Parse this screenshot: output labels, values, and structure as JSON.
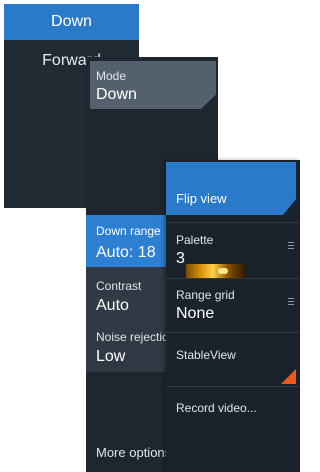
{
  "panel1": {
    "selected": "Down",
    "item": "Forward"
  },
  "panel2": {
    "mode_label": "Mode",
    "mode_value": "Down",
    "downrange_label": "Down range",
    "downrange_value": "Auto: 18",
    "contrast_label": "Contrast",
    "contrast_value": "Auto",
    "noise_label": "Noise rejection",
    "noise_value": "Low",
    "more_options": "More options"
  },
  "panel3": {
    "flip_view": "Flip view",
    "palette_label": "Palette",
    "palette_value": "3",
    "range_grid_label": "Range grid",
    "range_grid_value": "None",
    "stableview": "StableView",
    "record_video": "Record video..."
  },
  "colors": {
    "accent": "#2b79c9",
    "panel": "#1e2730",
    "record_indicator": "#ee5a1c"
  }
}
